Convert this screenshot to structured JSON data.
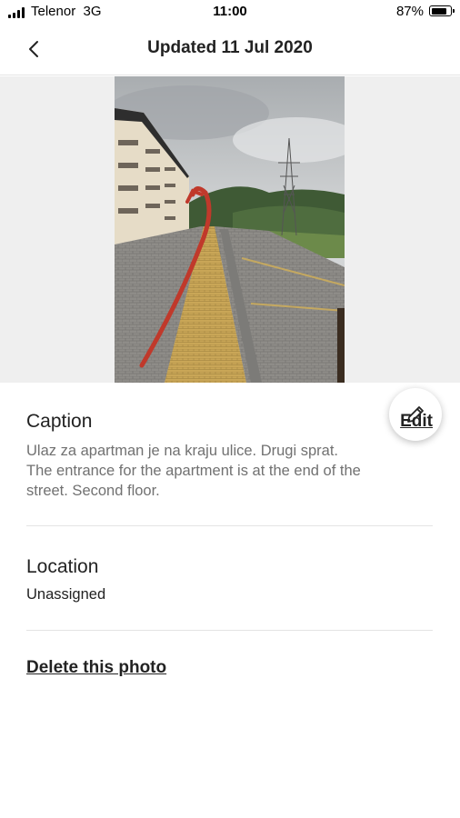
{
  "status_bar": {
    "carrier": "Telenor",
    "network": "3G",
    "time": "11:00",
    "battery": "87%",
    "battery_level": 0.87
  },
  "header": {
    "title": "Updated 11 Jul 2020",
    "back_icon": "chevron-left-icon"
  },
  "photo": {
    "edit_icon": "pencil-icon"
  },
  "caption": {
    "title": "Caption",
    "edit_label": "Edit",
    "line1": "Ulaz za apartman  je na kraju ulice. Drugi sprat.",
    "line2": "The entrance for the apartment is at the end of the",
    "line3": "street.  Second floor."
  },
  "location": {
    "title": "Location",
    "value": "Unassigned"
  },
  "actions": {
    "delete_label": "Delete this photo"
  }
}
